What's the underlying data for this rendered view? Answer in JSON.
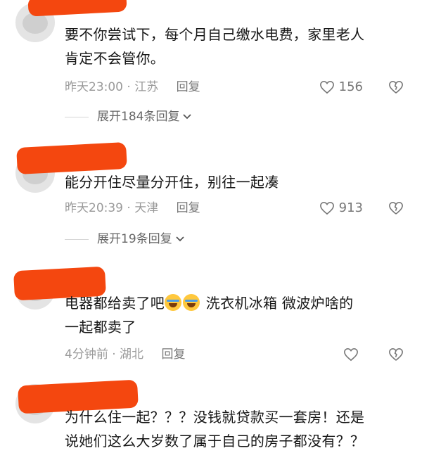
{
  "comments": [
    {
      "text": [
        "要不你尝试下，每个月自己缴水电费，家里老人",
        "肯定不会管你。"
      ],
      "time": "昨天23:00",
      "location": "江苏",
      "reply_label": "回复",
      "likes": "156",
      "expand_label": "展开184条回复"
    },
    {
      "text": [
        "能分开住尽量分开住，别往一起凑"
      ],
      "time": "昨天20:39",
      "location": "天津",
      "reply_label": "回复",
      "likes": "913",
      "expand_label": "展开19条回复"
    },
    {
      "text_prefix": "电器都给卖了吧",
      "text_suffix": " 洗衣机冰箱 微波炉啥的",
      "text_line2": "一起都卖了",
      "time": "4分钟前",
      "location": "湖北",
      "reply_label": "回复"
    },
    {
      "text": [
        "为什么住一起？？？没钱就贷款买一套房！还是",
        "说她们这么大岁数了属于自己的房子都没有？？"
      ]
    }
  ],
  "icons": {
    "like": "heart-outline-icon",
    "dislike": "broken-heart-outline-icon",
    "expand": "chevron-down-icon",
    "emoji": "laughing-tears-emoji"
  },
  "colors": {
    "redaction": "#f4470f",
    "meta_text": "#9a9a9a",
    "body_text": "#161616"
  }
}
